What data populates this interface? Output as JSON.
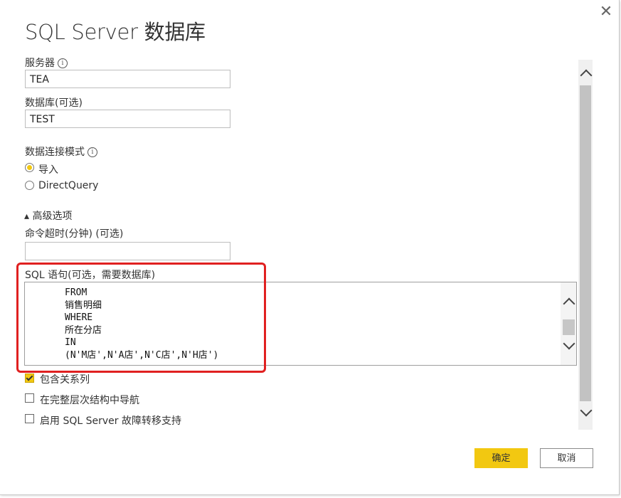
{
  "dialog": {
    "title": "SQL Server 数据库",
    "close_glyph": "✕"
  },
  "server": {
    "label": "服务器",
    "value": "TEA",
    "info_glyph": "i"
  },
  "database": {
    "label": "数据库(可选)",
    "value": "TEST"
  },
  "connectivity": {
    "label": "数据连接模式",
    "info_glyph": "i",
    "options": [
      {
        "label": "导入",
        "selected": true
      },
      {
        "label": "DirectQuery",
        "selected": false
      }
    ]
  },
  "advanced": {
    "toggle_label": "▴ 高级选项",
    "timeout_label": "命令超时(分钟) (可选)",
    "timeout_value": "",
    "sql_label": "SQL 语句(可选，需要数据库)",
    "sql_text": "FROM\n销售明细\nWHERE\n所在分店\nIN\n(N'M店',N'A店',N'C店',N'H店')"
  },
  "checkboxes": [
    {
      "label": "包含关系列",
      "checked": true
    },
    {
      "label": "在完整层次结构中导航",
      "checked": false
    },
    {
      "label": "启用 SQL Server 故障转移支持",
      "checked": false
    }
  ],
  "buttons": {
    "ok": "确定",
    "cancel": "取消"
  },
  "colors": {
    "accent": "#f2c811",
    "highlight": "#e02020"
  }
}
